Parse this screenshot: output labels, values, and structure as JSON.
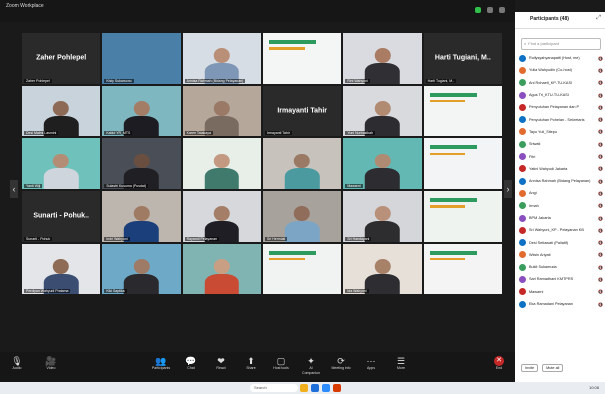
{
  "app": {
    "title": "Zoom Workplace"
  },
  "gallery": {
    "tiles": [
      {
        "name": "Zaher Pohlepel",
        "center_text": "Zaher Pohlepel",
        "bg": "#2a2a2a",
        "avatar": false
      },
      {
        "name": "Kisty Sukarsono",
        "center_text": "",
        "bg": "#4a7fa8",
        "avatar": false
      },
      {
        "name": "Annisa Rahmah (Bidang Pelayanan)",
        "center_text": "",
        "bg": "#d7dde4",
        "avatar": true,
        "skin": "#b98f78",
        "cloth": "#7f97b6"
      },
      {
        "name": "",
        "center_text": "",
        "bg": "#f3f6f4",
        "avatar": false,
        "banner": true
      },
      {
        "name": "Rini Wahyuni",
        "center_text": "",
        "bg": "#d9dbe0",
        "avatar": true,
        "skin": "#a97c63",
        "cloth": "#2f2f34"
      },
      {
        "name": "Harti Tugiani, M..",
        "center_text": "Harti Tugiani, M..",
        "bg": "#2a2a2a",
        "avatar": false
      },
      {
        "name": "Desi Malmi Lasmini",
        "center_text": "",
        "bg": "#c8d3dc",
        "avatar": true,
        "skin": "#8c6a55",
        "cloth": "#1f1f1f"
      },
      {
        "name": "Kabid YR_MTS",
        "center_text": "",
        "bg": "#7fb7c1",
        "avatar": true,
        "skin": "#a47d66",
        "cloth": "#1d1c22"
      },
      {
        "name": "Karen Tatakaya",
        "center_text": "",
        "bg": "#b5a79a",
        "avatar": true,
        "skin": "#9a7a66",
        "cloth": "#7a6b60"
      },
      {
        "name": "Irmayanti Tahir",
        "center_text": "Irmayanti Tahir",
        "bg": "#2a2a2a",
        "avatar": false
      },
      {
        "name": "Yuni Nurhasibah",
        "center_text": "",
        "bg": "#d8dade",
        "avatar": true,
        "skin": "#b18a72",
        "cloth": "#2c2c31"
      },
      {
        "name": "",
        "center_text": "",
        "bg": "#f2f5f3",
        "avatar": false,
        "banner": true
      },
      {
        "name": "Yanti Wiji",
        "center_text": "",
        "bg": "#6fc1bb",
        "avatar": true,
        "skin": "#b38d75",
        "cloth": "#cfd5dc"
      },
      {
        "name": "Sulastri Kusuma (Pusdat)",
        "center_text": "",
        "bg": "#4a4f57",
        "avatar": true,
        "skin": "#6a4f40",
        "cloth": "#1f1f24"
      },
      {
        "name": "",
        "center_text": "",
        "bg": "#e8efe9",
        "avatar": true,
        "skin": "#c39a81",
        "cloth": "#3f7a6c"
      },
      {
        "name": "",
        "center_text": "",
        "bg": "#c7c2bb",
        "avatar": true,
        "skin": "#9b7a65",
        "cloth": "#4a9aa0"
      },
      {
        "name": "Mawarni",
        "center_text": "",
        "bg": "#64b8b3",
        "avatar": true,
        "skin": "#b08b73",
        "cloth": "#2c2c31"
      },
      {
        "name": "",
        "center_text": "",
        "bg": "#f2f4f6",
        "avatar": false,
        "banner": true
      },
      {
        "name": "Sunarti - Pohuk",
        "center_text": "Sunarti - Pohuk..",
        "bg": "#2a2a2a",
        "avatar": false
      },
      {
        "name": "Indri Wahyuni",
        "center_text": "",
        "bg": "#bdb6ae",
        "avatar": true,
        "skin": "#9f7b63",
        "cloth": "#1b3f7a"
      },
      {
        "name": "Rayandi Pelayanan",
        "center_text": "",
        "bg": "#d6d8dc",
        "avatar": true,
        "skin": "#a47e66",
        "cloth": "#1e1e24"
      },
      {
        "name": "Sri Hermiati",
        "center_text": "",
        "bg": "#a7a39c",
        "avatar": true,
        "skin": "#8f6d5a",
        "cloth": "#7ca4c4"
      },
      {
        "name": "Sri Handayani",
        "center_text": "",
        "bg": "#d4d6da",
        "avatar": true,
        "skin": "#b9917a",
        "cloth": "#2d2d30"
      },
      {
        "name": "",
        "center_text": "",
        "bg": "#eef3f0",
        "avatar": false,
        "banner": true
      },
      {
        "name": "Perdiyan Wahyudi Pratama",
        "center_text": "",
        "bg": "#e3e5e8",
        "avatar": true,
        "skin": "#8e6b55",
        "cloth": "#3b4e72"
      },
      {
        "name": "Kiki Saptika",
        "center_text": "",
        "bg": "#6fa9c8",
        "avatar": true,
        "skin": "#9e7b67",
        "cloth": "#2a2a2e"
      },
      {
        "name": "",
        "center_text": "",
        "bg": "#7fb4b3",
        "avatar": true,
        "skin": "#c99f84",
        "cloth": "#c94b33"
      },
      {
        "name": "",
        "center_text": "",
        "bg": "#f1f3f2",
        "avatar": false,
        "banner": true
      },
      {
        "name": "Ida Wahyuni",
        "center_text": "",
        "bg": "#e6e0d9",
        "avatar": true,
        "skin": "#a88169",
        "cloth": "#2d2d32"
      },
      {
        "name": "",
        "center_text": "",
        "bg": "#f4f4f4",
        "avatar": false,
        "banner": true
      }
    ]
  },
  "toolbar": {
    "buttons": [
      {
        "icon": "🎙",
        "label": "Audio",
        "name": "audio-button"
      },
      {
        "icon": "🎥",
        "label": "Video",
        "name": "video-button"
      },
      {
        "icon": "👥",
        "label": "Participants",
        "name": "participants-button"
      },
      {
        "icon": "💬",
        "label": "Chat",
        "name": "chat-button"
      },
      {
        "icon": "❤",
        "label": "React",
        "name": "react-button"
      },
      {
        "icon": "⬆",
        "label": "Share",
        "name": "share-button"
      },
      {
        "icon": "▢",
        "label": "Host tools",
        "name": "host-tools-button"
      },
      {
        "icon": "✦",
        "label": "AI Companion",
        "name": "ai-companion-button"
      },
      {
        "icon": "⟳",
        "label": "Meeting info",
        "name": "meeting-info-button"
      },
      {
        "icon": "⋯",
        "label": "Apps",
        "name": "apps-button"
      },
      {
        "icon": "☰",
        "label": "More",
        "name": "more-button"
      },
      {
        "icon": "✕",
        "label": "End",
        "name": "end-button"
      }
    ]
  },
  "panel": {
    "title": "Participants (48)",
    "search_placeholder": "Find a participant",
    "participants": [
      "Rullysyahyanapatti (Host, me)",
      "Yulia Wahyudin (Co-host)",
      "Ani Rohaeti_KP-TU-KASI",
      "Agus Tri_KTU-TU-KASI",
      "Penyuluhan Pelayanan dan P",
      "Penyuluhan Pohelan - Sekretaris",
      "Tayu Yuli_Sitepu",
      "Sriwati",
      "Fitri",
      "Yatini Wahyudi Jakarta",
      "Annisa Rahmah (Bidang Pelayanan)",
      "Angi",
      "Irmah",
      "BPM Jakarta",
      "Sri Wahyuni_KP - Pelayanan KB",
      "Desi Setiawati (Paliatif)",
      "Wiwin Ariyati",
      "Bukit Sukamuda",
      "Sari Ramadhani KMTPRS",
      "Mawarni",
      "Eka Ramadani Pelayanan"
    ],
    "footer": {
      "invite_label": "Invite",
      "mute_all_label": "Mute all"
    }
  },
  "taskbar": {
    "search_label": "Search",
    "time": "10:08"
  }
}
